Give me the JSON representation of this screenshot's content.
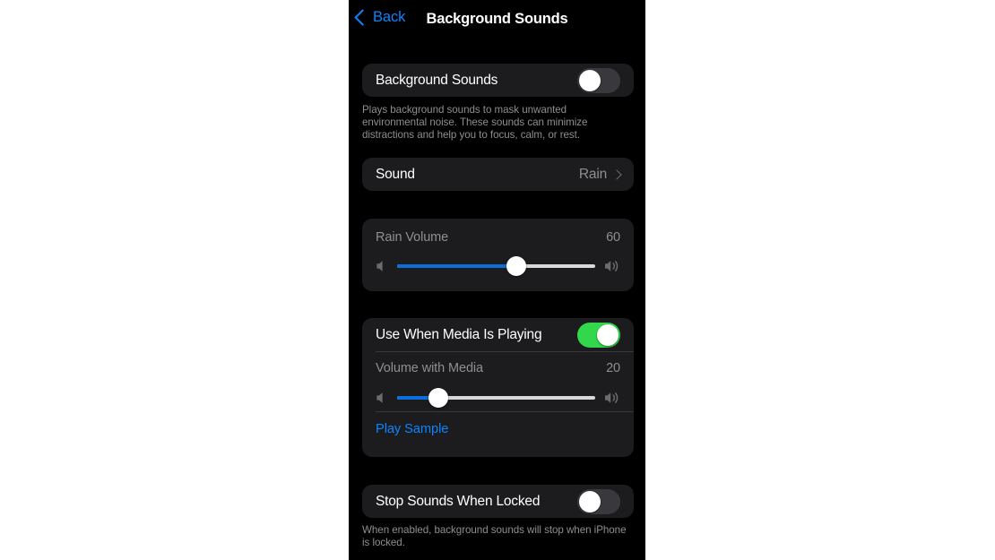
{
  "navbar": {
    "back_label": "Back",
    "title": "Background Sounds"
  },
  "background_sounds": {
    "label": "Background Sounds",
    "enabled": false,
    "footnote": "Plays background sounds to mask unwanted environmental noise. These sounds can minimize distractions and help you to focus, calm, or rest."
  },
  "sound_row": {
    "label": "Sound",
    "value": "Rain"
  },
  "rain_volume": {
    "label": "Rain Volume",
    "value": "60",
    "percent": 60,
    "min_icon": "speaker-mute-icon",
    "max_icon": "speaker-wave-icon"
  },
  "use_when_media": {
    "label": "Use When Media Is Playing",
    "enabled": true
  },
  "volume_with_media": {
    "label": "Volume with Media",
    "value": "20",
    "percent": 21,
    "min_icon": "speaker-mute-icon",
    "max_icon": "speaker-wave-icon"
  },
  "play_sample": {
    "label": "Play Sample"
  },
  "stop_when_locked": {
    "label": "Stop Sounds When Locked",
    "enabled": false,
    "footnote": "When enabled, background sounds will stop when iPhone is locked."
  },
  "colors": {
    "accent_blue": "#0a84ff",
    "toggle_on_green": "#32d74b",
    "toggle_off_gray": "#39393d",
    "card_bg": "#1c1c1e",
    "page_bg": "#000000",
    "slider_fill": "#0a6edd",
    "secondary_text": "#8e8e93"
  }
}
